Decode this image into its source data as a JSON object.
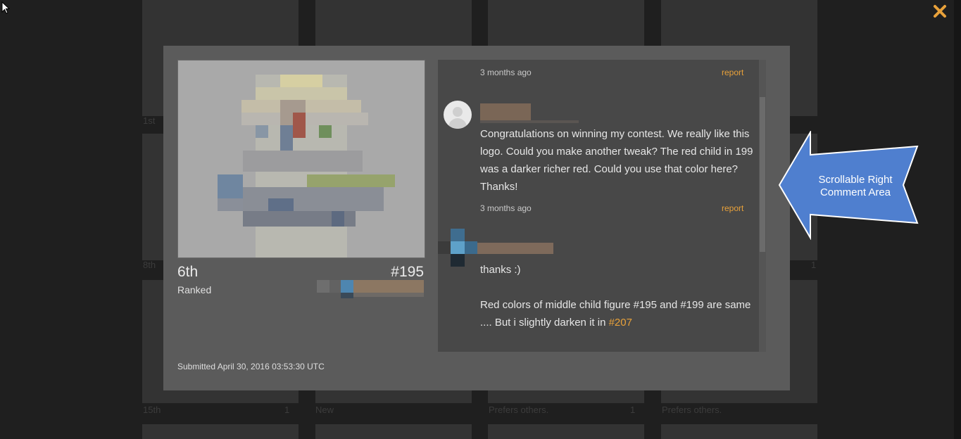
{
  "gallery": {
    "captions": [
      "1st",
      "8th",
      "15th",
      "New",
      "Prefers others.",
      "Prefers others."
    ],
    "comment_counts": [
      "1",
      "1",
      "1"
    ]
  },
  "modal": {
    "close_icon": "close-x-icon",
    "rank": "6th",
    "rank_label": "Ranked",
    "entry_number": "#195",
    "submitted": "Submitted April 30, 2016 03:53:30 UTC",
    "comments": [
      {
        "time": "3 months ago",
        "report": "report"
      },
      {
        "text": "Congratulations on winning my contest. We really like this logo. Could you make another tweak? The red child in 199 was a darker richer red. Could you use that color here? Thanks!",
        "time": "3 months ago",
        "report": "report"
      },
      {
        "line1": "thanks :)",
        "line2_prefix": "Red colors of middle child figure #195 and #199 are same .... But i slightly darken it in ",
        "link": "#207"
      }
    ]
  },
  "callout": {
    "text": "Scrollable Right Comment Area",
    "color": "#4f7fcf"
  },
  "colors": {
    "accent": "#e8a13a",
    "modal_bg": "#5b5b5b",
    "comments_bg": "#484848"
  }
}
